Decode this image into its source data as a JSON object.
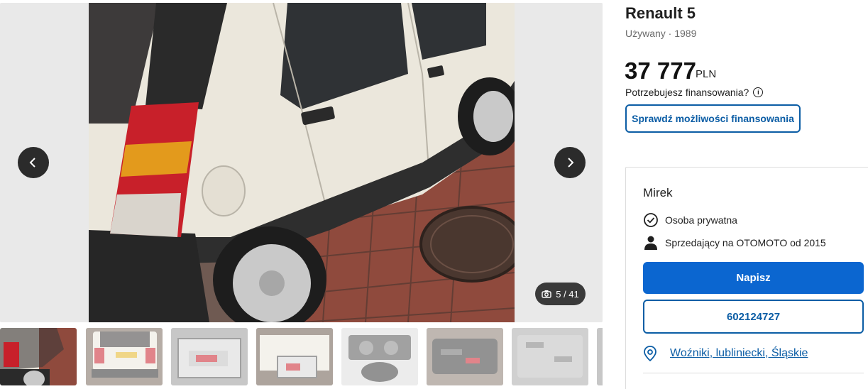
{
  "gallery": {
    "counter": "5 / 41",
    "prev_icon": "chevron-left-icon",
    "next_icon": "chevron-right-icon",
    "camera_icon": "camera-icon",
    "active_thumb": 1,
    "thumb_count": 8
  },
  "listing": {
    "title": "Renault 5",
    "subtitle": "Używany · 1989",
    "price": "37 777",
    "currency": "PLN",
    "finance_question": "Potrzebujesz finansowania?",
    "finance_button": "Sprawdź możliwości finansowania"
  },
  "seller": {
    "name": "Mirek",
    "type": "Osoba prywatna",
    "since": "Sprzedający na OTOMOTO od 2015",
    "write_button": "Napisz",
    "phone": "602124727",
    "location": "Woźniki, lubliniecki, Śląskie"
  },
  "colors": {
    "brand_blue": "#0b66d0",
    "link_blue": "#0b5da5",
    "car_body": "#ebe7dc",
    "brick": "#8f4a3d"
  }
}
